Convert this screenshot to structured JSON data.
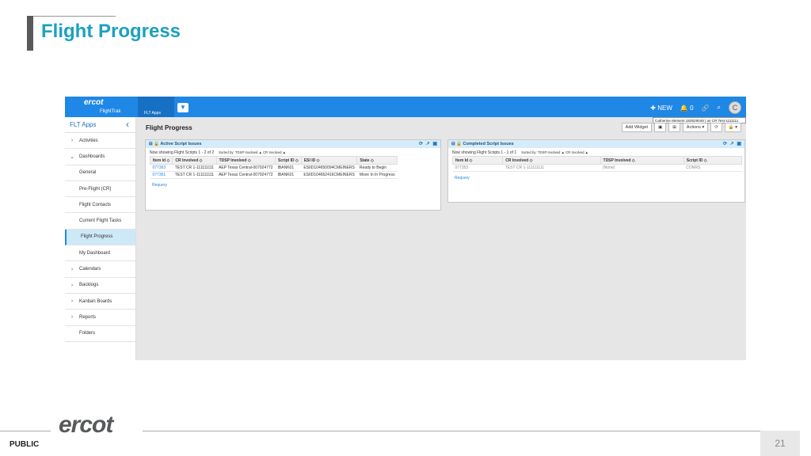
{
  "slide": {
    "title": "Flight Progress",
    "footer_label": "PUBLIC",
    "page_number": "21",
    "logo_text": "ercot"
  },
  "app": {
    "logo": "ercot",
    "logo_sub": "FlightTrak",
    "apps_tab": "FLT Apps",
    "nav_new": "NEW",
    "nav_bell_count": "0",
    "avatar_initial": "C",
    "tooltip": "Catherine Meiners 183529049 | as CR Test-1111111",
    "colors": {
      "accent": "#1f87e6",
      "title": "#1ba1bf"
    }
  },
  "sidebar": {
    "header": "FLT Apps",
    "items": [
      {
        "label": "Activities",
        "arrow": ">"
      },
      {
        "label": "Dashboards",
        "arrow": "v"
      },
      {
        "label": "General",
        "arrow": ""
      },
      {
        "label": "Pre-Flight (CR)",
        "arrow": ""
      },
      {
        "label": "Flight Contacts",
        "arrow": ""
      },
      {
        "label": "Current Flight Tasks",
        "arrow": ""
      },
      {
        "label": "Flight Progress",
        "arrow": ""
      },
      {
        "label": "My Dashboard",
        "arrow": ""
      },
      {
        "label": "Calendars",
        "arrow": ">"
      },
      {
        "label": "Backlogs",
        "arrow": ">"
      },
      {
        "label": "Kanban Boards",
        "arrow": ">"
      },
      {
        "label": "Reports",
        "arrow": ">"
      },
      {
        "label": "Folders",
        "arrow": ""
      }
    ]
  },
  "main": {
    "title": "Flight Progress",
    "toolbar": {
      "add_widget": "Add Widget",
      "actions": "Actions"
    }
  },
  "active_widget": {
    "title": "Active Script Issues",
    "showing": "Now showing Flight Scripts 1 - 2 of 2",
    "sorted": "Sorted by: TDSP Involved ▲ CR Involved ▲",
    "columns": [
      "Item Id ◇",
      "CR Involved ◇",
      "TDSP Involved ◇",
      "Script ID ◇",
      "ESI ID ◇",
      "State ◇"
    ],
    "rows": [
      [
        "077363",
        "TEST CR 1-111111111",
        "AEP Texas Central-007924772",
        "IBANK01",
        "ESIID104650094CMEINERS",
        "Ready to Begin"
      ],
      [
        "077361",
        "TEST CR 1-111111111",
        "AEP Texas Central-007924772",
        "IBANK01",
        "ESIID104652416CMEINERS",
        "Move In In Progress"
      ]
    ],
    "link": "Requery"
  },
  "completed_widget": {
    "title": "Completed Script Issues",
    "showing": "Now showing Flight Scripts 1 - 1 of 1",
    "sorted": "Sorted by: TDSP Involved ▲ CR Involved ▲",
    "columns": [
      "Item Id ◇",
      "CR Involved ◇",
      "TDSP Involved ◇",
      "Script ID ◇"
    ],
    "rows": [
      [
        "077353",
        "TEST CR 1-111111111",
        "(None)",
        "CONRS"
      ]
    ],
    "link": "Requery"
  }
}
